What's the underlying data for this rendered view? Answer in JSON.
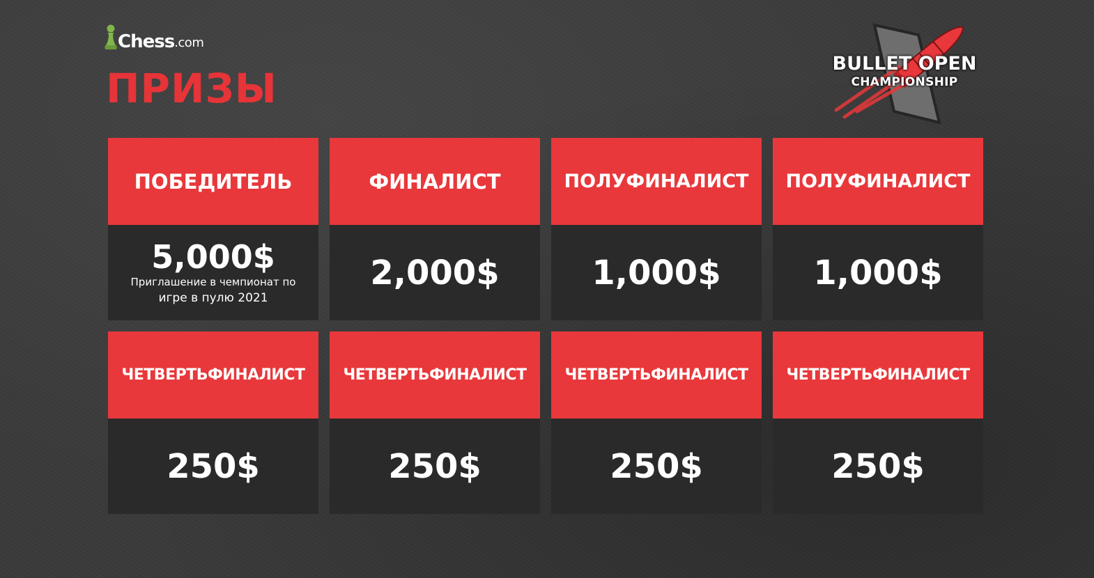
{
  "brand": {
    "name": "Chess",
    "suffix": ".com"
  },
  "title": "ПРИЗЫ",
  "event": {
    "line1": "BULLET OPEN",
    "line2": "CHAMPIONSHIP"
  },
  "colors": {
    "accent": "#e8383b",
    "card_body": "#2a2a2a",
    "background": "#3a3a3a",
    "pawn": "#81b64c"
  },
  "prizes": [
    {
      "place": "ПОБЕДИТЕЛЬ",
      "amount": "5,000$",
      "note_line1": "Приглашение в чемпионат по",
      "note_line2": "игре в пулю 2021"
    },
    {
      "place": "ФИНАЛИСТ",
      "amount": "2,000$"
    },
    {
      "place": "ПОЛУФИНАЛИСТ",
      "amount": "1,000$"
    },
    {
      "place": "ПОЛУФИНАЛИСТ",
      "amount": "1,000$"
    },
    {
      "place": "ЧЕТВЕРТЬФИНАЛИСТ",
      "amount": "250$"
    },
    {
      "place": "ЧЕТВЕРТЬФИНАЛИСТ",
      "amount": "250$"
    },
    {
      "place": "ЧЕТВЕРТЬФИНАЛИСТ",
      "amount": "250$"
    },
    {
      "place": "ЧЕТВЕРТЬФИНАЛИСТ",
      "amount": "250$"
    }
  ]
}
